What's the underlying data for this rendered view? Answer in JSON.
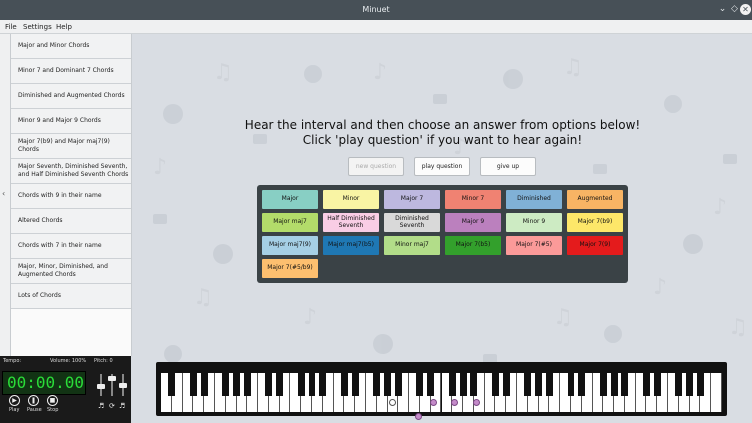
{
  "window": {
    "title": "Minuet"
  },
  "menu": [
    "File",
    "Settings",
    "Help"
  ],
  "sidebar": {
    "items": [
      "Major and Minor Chords",
      "Minor 7 and Dominant 7 Chords",
      "Diminished and Augmented Chords",
      "Minor 9 and Major 9 Chords",
      "Major 7(b9) and Major maj7(9) Chords",
      "Major Seventh, Diminished Seventh, and Half Diminished Seventh Chords",
      "Chords with 9 in their name",
      "Altered Chords",
      "Chords with 7 in their name",
      "Major, Minor, Diminished, and Augmented Chords",
      "Lots of Chords"
    ]
  },
  "main": {
    "instruction_line1": "Hear the interval and then choose an answer from options below!",
    "instruction_line2": "Click 'play question' if you want to hear again!",
    "new_question": "new question",
    "play_question": "play question",
    "give_up": "give up"
  },
  "answers": [
    {
      "label": "Major",
      "color": "#88cfc4"
    },
    {
      "label": "Minor",
      "color": "#f9f4a4"
    },
    {
      "label": "Major 7",
      "color": "#bdb8df"
    },
    {
      "label": "Minor 7",
      "color": "#f08272"
    },
    {
      "label": "Diminished",
      "color": "#80b1d6"
    },
    {
      "label": "Augmented",
      "color": "#f8b464"
    },
    {
      "label": "Major maj7",
      "color": "#b3dc6a"
    },
    {
      "label": "Half Diminished Seventh",
      "color": "#f9cde5"
    },
    {
      "label": "Diminished Seventh",
      "color": "#d9d9d9"
    },
    {
      "label": "Major 9",
      "color": "#bb80be"
    },
    {
      "label": "Minor 9",
      "color": "#cdebc3"
    },
    {
      "label": "Major 7(b9)",
      "color": "#fde769"
    },
    {
      "label": "Major maj7(9)",
      "color": "#a5cfe5"
    },
    {
      "label": "Major maj7(b5)",
      "color": "#1f78b4"
    },
    {
      "label": "Minor maj7",
      "color": "#b2dd89"
    },
    {
      "label": "Major 7(b5)",
      "color": "#33a02c"
    },
    {
      "label": "Major 7(#5)",
      "color": "#fb9a99"
    },
    {
      "label": "Major 7(9)",
      "color": "#e41b1c"
    },
    {
      "label": "Major 7(#5/b9)",
      "color": "#fdbf6f"
    }
  ],
  "transport": {
    "tempo_label": "Tempo:",
    "volume_label": "Volume: 100%",
    "pitch_label": "Pitch: 0",
    "time": "00:00.00",
    "play": "Play",
    "pause": "Pause",
    "stop": "Stop"
  }
}
